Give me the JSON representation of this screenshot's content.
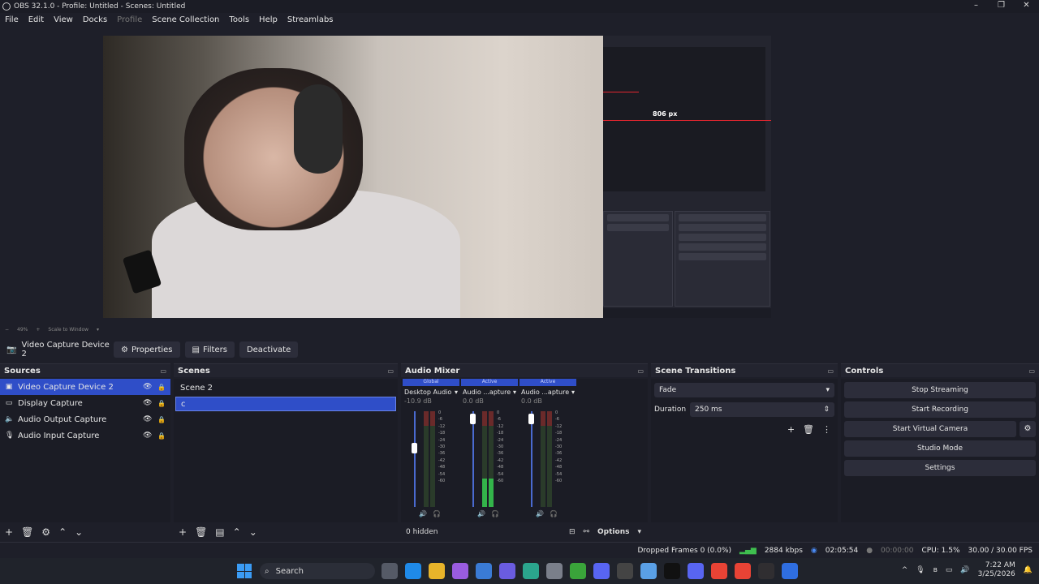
{
  "window": {
    "title": "OBS 32.1.0 - Profile: Untitled - Scenes: Untitled"
  },
  "menu": [
    "File",
    "Edit",
    "View",
    "Docks",
    "Profile",
    "Scene Collection",
    "Tools",
    "Help",
    "Streamlabs"
  ],
  "preview": {
    "overlay_label": "806 px",
    "zoom": "49%",
    "zoom_mode": "Scale to Window"
  },
  "source_toolbar": {
    "source_name": "Video Capture Device 2",
    "properties": "Properties",
    "filters": "Filters",
    "deactivate": "Deactivate"
  },
  "sources": {
    "title": "Sources",
    "items": [
      {
        "label": "Video Capture Device 2",
        "icon": "camera-icon"
      },
      {
        "label": "Display Capture",
        "icon": "monitor-icon"
      },
      {
        "label": "Audio Output Capture",
        "icon": "speaker-icon"
      },
      {
        "label": "Audio Input Capture",
        "icon": "microphone-icon"
      }
    ]
  },
  "scenes": {
    "title": "Scenes",
    "items": [
      "Scene 2",
      "c"
    ]
  },
  "mixer": {
    "title": "Audio Mixer",
    "channels": [
      {
        "tag": "Global",
        "name": "Desktop Audio",
        "db": "-10.9 dB",
        "fader_level": 0.62,
        "level": 0.0
      },
      {
        "tag": "Active",
        "name": "Audio ...apture",
        "db": "0.0 dB",
        "fader_level": 0.92,
        "level": 0.3
      },
      {
        "tag": "Active",
        "name": "Audio ...apture",
        "db": "0.0 dB",
        "fader_level": 0.92,
        "level": 0.0
      }
    ],
    "scale": [
      "0",
      "-6",
      "-12",
      "-18",
      "-24",
      "-30",
      "-36",
      "-42",
      "-48",
      "-54",
      "-60"
    ],
    "hidden_label": "0 hidden",
    "options_label": "Options"
  },
  "transitions": {
    "title": "Scene Transitions",
    "selected": "Fade",
    "duration_label": "Duration",
    "duration_value": "250 ms"
  },
  "controls": {
    "title": "Controls",
    "buttons": [
      "Stop Streaming",
      "Start Recording",
      "Start Virtual Camera",
      "Studio Mode",
      "Settings"
    ]
  },
  "status": {
    "dropped_frames": "Dropped Frames 0 (0.0%)",
    "bitrate": "2884 kbps",
    "stream_time": "02:05:54",
    "record_time": "00:00:00",
    "cpu": "CPU: 1.5%",
    "fps": "30.00 / 30.00 FPS"
  },
  "taskbar": {
    "search": "Search",
    "time": "7:22 AM",
    "date": "3/25/2026"
  }
}
